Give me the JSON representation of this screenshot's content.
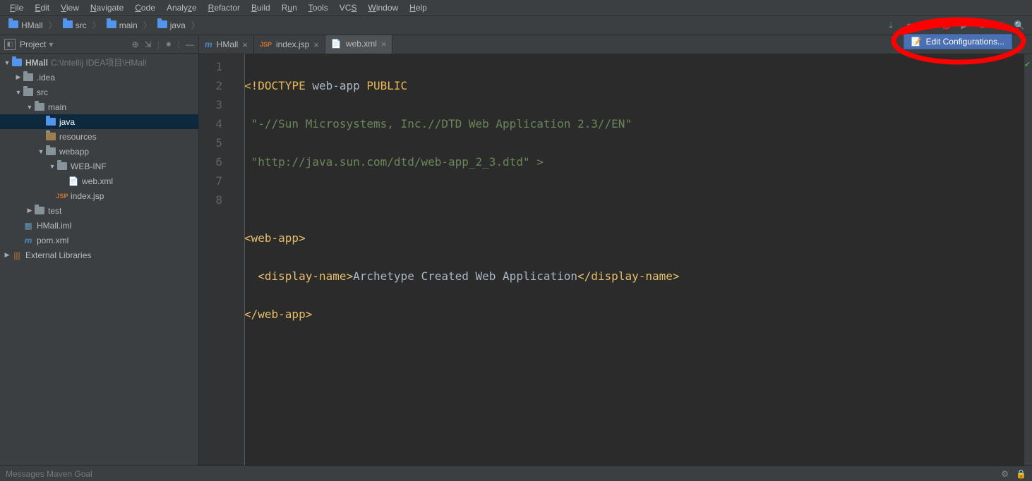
{
  "menu": {
    "items": [
      "File",
      "Edit",
      "View",
      "Navigate",
      "Code",
      "Analyze",
      "Refactor",
      "Build",
      "Run",
      "Tools",
      "VCS",
      "Window",
      "Help"
    ]
  },
  "breadcrumb": {
    "root": "HMall",
    "segs": [
      "src",
      "main",
      "java"
    ]
  },
  "project_panel": {
    "title": "Project"
  },
  "tree": {
    "root_name": "HMall",
    "root_path": "C:\\Intellij IDEA项目\\HMall",
    "idea": ".idea",
    "src": "src",
    "main": "main",
    "java": "java",
    "resources": "resources",
    "webapp": "webapp",
    "webinf": "WEB-INF",
    "webxml": "web.xml",
    "indexjsp": "index.jsp",
    "test": "test",
    "iml": "HMall.iml",
    "pom": "pom.xml",
    "extlib": "External Libraries"
  },
  "tabs": {
    "t0": "HMall",
    "t1": "index.jsp",
    "t2": "web.xml"
  },
  "gutter_lines": [
    "1",
    "2",
    "3",
    "4",
    "5",
    "6",
    "7",
    "8"
  ],
  "code": {
    "l1_a": "<!DOCTYPE ",
    "l1_b": "web-app ",
    "l1_c": "PUBLIC",
    "l2": " \"-//Sun Microsystems, Inc.//DTD Web Application 2.3//EN\"",
    "l3": " \"http://java.sun.com/dtd/web-app_2_3.dtd\" >",
    "l5_open": "<web-app>",
    "l6_a": "  <display-name>",
    "l6_b": "Archetype Created Web Application",
    "l6_c": "</display-name>",
    "l7_close": "</web-app>"
  },
  "edit_config": {
    "label": "Edit Configurations..."
  },
  "status": {
    "left": "Messages Maven Goal"
  }
}
